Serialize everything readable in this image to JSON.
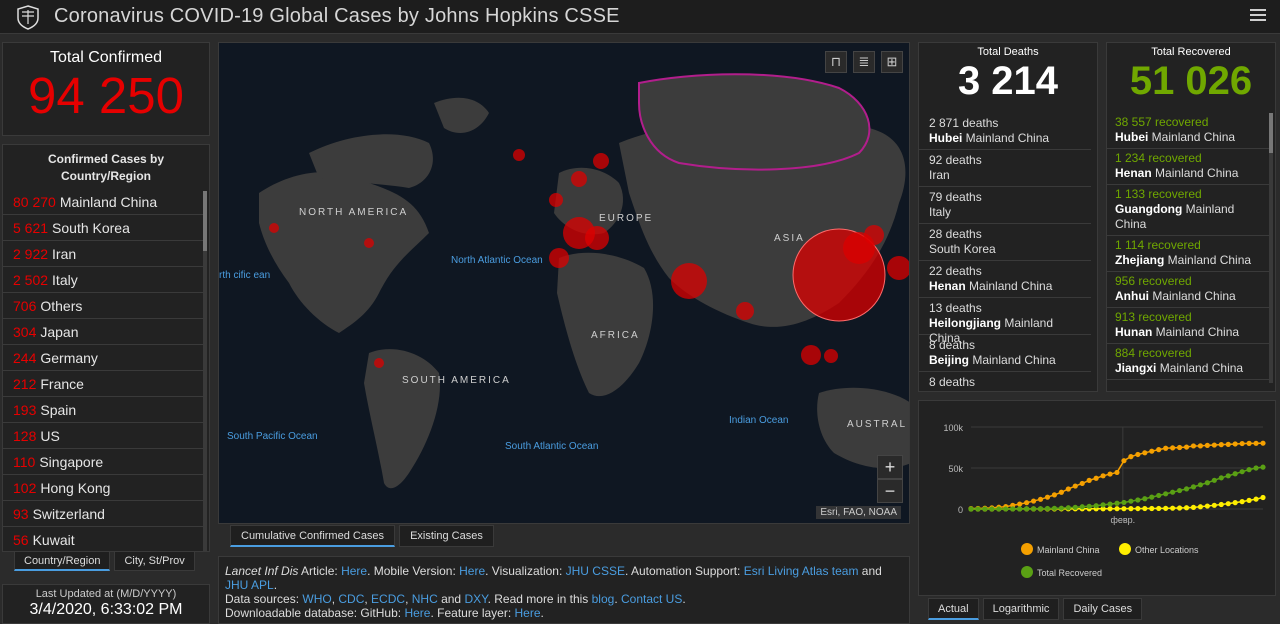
{
  "header": {
    "title": "Coronavirus COVID-19 Global Cases by Johns Hopkins CSSE"
  },
  "total_confirmed": {
    "label": "Total Confirmed",
    "value": "94 250"
  },
  "country_panel": {
    "title": "Confirmed Cases by Country/Region",
    "rows": [
      {
        "num": "80 270",
        "name": "Mainland China"
      },
      {
        "num": "5 621",
        "name": "South Korea"
      },
      {
        "num": "2 922",
        "name": "Iran"
      },
      {
        "num": "2 502",
        "name": "Italy"
      },
      {
        "num": "706",
        "name": "Others"
      },
      {
        "num": "304",
        "name": "Japan"
      },
      {
        "num": "244",
        "name": "Germany"
      },
      {
        "num": "212",
        "name": "France"
      },
      {
        "num": "193",
        "name": "Spain"
      },
      {
        "num": "128",
        "name": "US"
      },
      {
        "num": "110",
        "name": "Singapore"
      },
      {
        "num": "102",
        "name": "Hong Kong"
      },
      {
        "num": "93",
        "name": "Switzerland"
      },
      {
        "num": "56",
        "name": "Kuwait"
      }
    ]
  },
  "left_tabs": [
    "Country/Region",
    "City, St/Prov"
  ],
  "last_updated": {
    "label": "Last Updated at (M/D/YYYY)",
    "value": "3/4/2020, 6:33:02 PM"
  },
  "map": {
    "labels": {
      "north_america": "NORTH AMERICA",
      "south_america": "SOUTH AMERICA",
      "europe": "EUROPE",
      "africa": "AFRICA",
      "asia": "ASIA",
      "australia": "AUSTRAL",
      "north_atlantic": "North Atlantic Ocean",
      "north_pacific": "rth cific ean",
      "south_pacific": "South Pacific Ocean",
      "south_atlantic": "South Atlantic Ocean",
      "indian": "Indian Ocean"
    },
    "attribution": "Esri, FAO, NOAA",
    "zoom_in": "+",
    "zoom_out": "−"
  },
  "map_tabs": [
    "Cumulative Confirmed Cases",
    "Existing Cases"
  ],
  "info": {
    "l1": "Lancet Inf Dis",
    "l2": " Article: ",
    "l3": "Here",
    "l4": ". Mobile Version: ",
    "l5": "Here",
    "l6": ". Visualization: ",
    "l7": "JHU CSSE",
    "l8": ". Automation Support: ",
    "l9": "Esri Living Atlas team",
    "l10": " and ",
    "l11": "JHU APL",
    "l12": ".",
    "m1": "Data sources: ",
    "m2": "WHO",
    "m3": ", ",
    "m4": "CDC",
    "m5": ", ",
    "m6": "ECDC",
    "m7": ", ",
    "m8": "NHC",
    "m9": " and ",
    "m10": "DXY",
    "m11": ". Read more in this ",
    "m12": "blog",
    "m13": ". ",
    "m14": "Contact US",
    "m15": ".",
    "n1": "Downloadable database: GitHub: ",
    "n2": "Here",
    "n3": ". Feature layer: ",
    "n4": "Here",
    "n5": "."
  },
  "deaths": {
    "label": "Total Deaths",
    "value": "3 214",
    "rows": [
      {
        "count": "2 871 deaths",
        "region": "Hubei",
        "country": " Mainland China"
      },
      {
        "count": "92 deaths",
        "region": "",
        "country": "Iran"
      },
      {
        "count": "79 deaths",
        "region": "",
        "country": "Italy"
      },
      {
        "count": "28 deaths",
        "region": "",
        "country": "South Korea"
      },
      {
        "count": "22 deaths",
        "region": "Henan",
        "country": " Mainland China"
      },
      {
        "count": "13 deaths",
        "region": "Heilongjiang",
        "country": " Mainland China"
      },
      {
        "count": "8 deaths",
        "region": "Beijing",
        "country": " Mainland China"
      },
      {
        "count": "8 deaths",
        "region": "",
        "country": ""
      }
    ]
  },
  "recovered": {
    "label": "Total Recovered",
    "value": "51 026",
    "rows": [
      {
        "count": "38 557 recovered",
        "region": "Hubei",
        "country": " Mainland China"
      },
      {
        "count": "1 234 recovered",
        "region": "Henan",
        "country": " Mainland China"
      },
      {
        "count": "1 133 recovered",
        "region": "Guangdong",
        "country": " Mainland China"
      },
      {
        "count": "1 114 recovered",
        "region": "Zhejiang",
        "country": " Mainland China"
      },
      {
        "count": "956 recovered",
        "region": "Anhui",
        "country": " Mainland China"
      },
      {
        "count": "913 recovered",
        "region": "Hunan",
        "country": " Mainland China"
      },
      {
        "count": "884 recovered",
        "region": "Jiangxi",
        "country": " Mainland China"
      }
    ]
  },
  "chart_tabs": [
    "Actual",
    "Logarithmic",
    "Daily Cases"
  ],
  "colors": {
    "confirmed": "#e60000",
    "recovered": "#70a800",
    "link": "#4a9de0",
    "mainland": "#f5a000",
    "other": "#ffee00",
    "total_recovered": "#5aa014"
  },
  "chart_data": {
    "type": "line",
    "y_ticks": [
      "100k",
      "50k",
      "0"
    ],
    "ylim": [
      0,
      100000
    ],
    "x_tick_label": "февр.",
    "x": [
      0,
      1,
      2,
      3,
      4,
      5,
      6,
      7,
      8,
      9,
      10,
      11,
      12,
      13,
      14,
      15,
      16,
      17,
      18,
      19,
      20,
      21,
      22,
      23,
      24,
      25,
      26,
      27,
      28,
      29,
      30,
      31,
      32,
      33,
      34,
      35,
      36,
      37,
      38,
      39,
      40,
      41,
      42
    ],
    "series": [
      {
        "name": "Mainland China",
        "color": "#f5a000",
        "values": [
          550,
          640,
          920,
          1400,
          2100,
          2900,
          4500,
          6000,
          7700,
          9700,
          11800,
          14400,
          17200,
          20400,
          24400,
          28000,
          31200,
          34900,
          37500,
          40500,
          42600,
          44600,
          58900,
          63900,
          66500,
          68500,
          70500,
          72400,
          74100,
          74500,
          75000,
          75500,
          76900,
          77000,
          77600,
          78000,
          78500,
          78800,
          79300,
          79800,
          80000,
          80100,
          80270
        ]
      },
      {
        "name": "Other Locations",
        "color": "#ffee00",
        "values": [
          0,
          10,
          20,
          30,
          40,
          60,
          80,
          100,
          130,
          150,
          160,
          170,
          180,
          190,
          200,
          220,
          240,
          260,
          300,
          320,
          340,
          360,
          400,
          450,
          500,
          550,
          620,
          700,
          800,
          1000,
          1200,
          1500,
          2000,
          2700,
          3600,
          4500,
          5500,
          6500,
          7800,
          9000,
          10500,
          12000,
          14000
        ]
      },
      {
        "name": "Total Recovered",
        "color": "#5aa014",
        "values": [
          30,
          40,
          50,
          60,
          70,
          100,
          120,
          150,
          200,
          300,
          400,
          600,
          800,
          1000,
          1500,
          2000,
          2700,
          3300,
          4000,
          5000,
          6000,
          7000,
          8000,
          9500,
          11000,
          12500,
          14500,
          16500,
          18500,
          20500,
          22500,
          24500,
          27000,
          29500,
          32000,
          35000,
          38000,
          40500,
          43000,
          45500,
          48000,
          50000,
          51026
        ]
      }
    ]
  }
}
